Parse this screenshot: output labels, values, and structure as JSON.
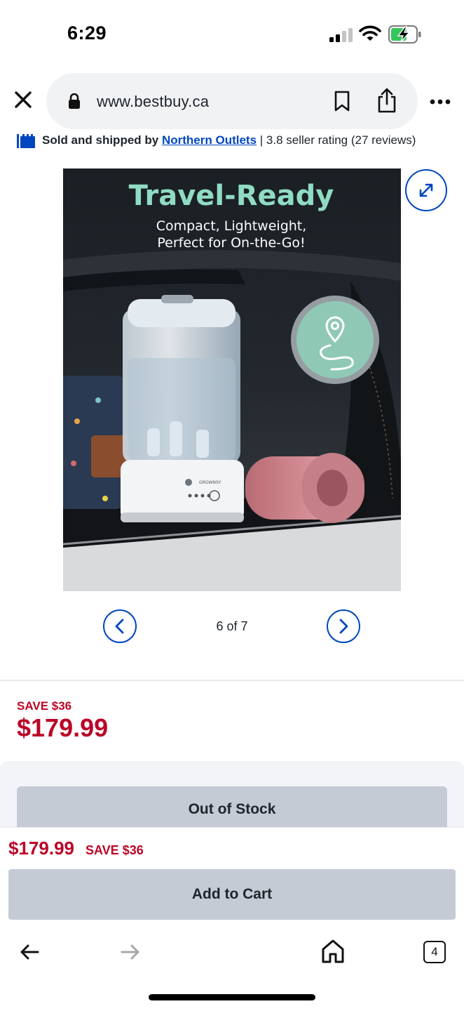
{
  "status_bar": {
    "time": "6:29"
  },
  "browser": {
    "url": "www.bestbuy.ca",
    "tab_count": "4"
  },
  "seller": {
    "prefix": "Sold and shipped by",
    "name": "Northern Outlets",
    "rating": "| 3.8 seller rating (27 reviews)"
  },
  "image": {
    "headline": "Travel-Ready",
    "subline1": "Compact, Lightweight,",
    "subline2": "Perfect for On-the-Go!",
    "product_brand": "GROWNSY"
  },
  "pager": {
    "text": "6 of 7"
  },
  "pricing": {
    "save_label": "SAVE $36",
    "price": "$179.99"
  },
  "stock_button": "Out of Stock",
  "sticky": {
    "price": "$179.99",
    "save_label": "SAVE $36",
    "cart_button": "Add to Cart"
  },
  "colors": {
    "brand_blue": "#0046be",
    "sale_red": "#bb0628",
    "disabled_button": "#c5cbd5",
    "headline_teal": "#8fdcc3"
  }
}
